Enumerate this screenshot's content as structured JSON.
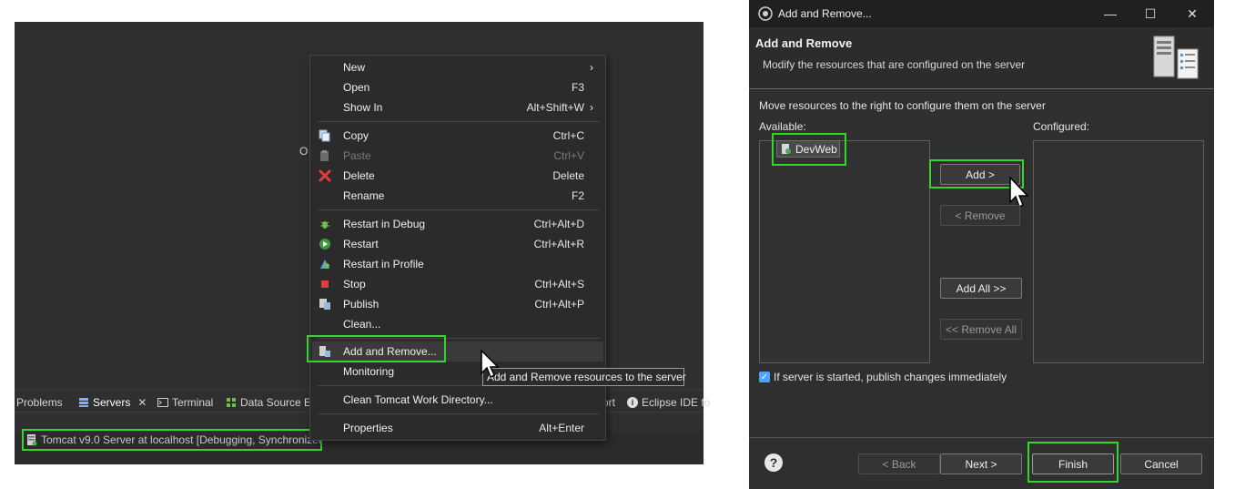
{
  "eclipse": {
    "stray_text": "O",
    "tabs": [
      {
        "label": "Problems"
      },
      {
        "label": "Servers"
      },
      {
        "label": "Terminal"
      },
      {
        "label": "Data Source E"
      },
      {
        "label": "ort"
      },
      {
        "label": "Eclipse IDE fo"
      }
    ],
    "server_row": "Tomcat v9.0 Server at localhost  [Debugging, Synchronized]"
  },
  "context_menu": {
    "items": [
      {
        "label": "New",
        "shortcut": "",
        "submenu": true
      },
      {
        "label": "Open",
        "shortcut": "F3"
      },
      {
        "label": "Show In",
        "shortcut": "Alt+Shift+W",
        "submenu": true
      },
      {
        "label": "Copy",
        "shortcut": "Ctrl+C"
      },
      {
        "label": "Paste",
        "shortcut": "Ctrl+V",
        "disabled": true
      },
      {
        "label": "Delete",
        "shortcut": "Delete"
      },
      {
        "label": "Rename",
        "shortcut": "F2"
      },
      {
        "label": "Restart in Debug",
        "shortcut": "Ctrl+Alt+D"
      },
      {
        "label": "Restart",
        "shortcut": "Ctrl+Alt+R"
      },
      {
        "label": "Restart in Profile",
        "shortcut": ""
      },
      {
        "label": "Stop",
        "shortcut": "Ctrl+Alt+S"
      },
      {
        "label": "Publish",
        "shortcut": "Ctrl+Alt+P"
      },
      {
        "label": "Clean...",
        "shortcut": ""
      },
      {
        "label": "Add and Remove...",
        "shortcut": ""
      },
      {
        "label": "Monitoring",
        "shortcut": ""
      },
      {
        "label": "Clean Tomcat Work Directory...",
        "shortcut": ""
      },
      {
        "label": "Properties",
        "shortcut": "Alt+Enter"
      }
    ],
    "tooltip": "Add and Remove resources to the server"
  },
  "dialog": {
    "title": "Add and Remove...",
    "window_buttons": {
      "minimize": "—",
      "maximize": "☐",
      "close": "✕"
    },
    "banner_title": "Add and Remove",
    "banner_desc": "Modify the resources that are configured on the server",
    "instruction": "Move resources to the right to configure them on the server",
    "available_label": "Available:",
    "configured_label": "Configured:",
    "available_items": [
      "DevWeb"
    ],
    "buttons": {
      "add": "Add >",
      "remove": "< Remove",
      "add_all": "Add All >>",
      "remove_all": "<< Remove All",
      "back": "< Back",
      "next": "Next >",
      "finish": "Finish",
      "cancel": "Cancel"
    },
    "publish_checkbox": {
      "label": "If server is started, publish changes immediately",
      "checked": true
    },
    "help": "?"
  },
  "colors": {
    "highlight": "#35d62b",
    "accent": "#4da3ff"
  }
}
